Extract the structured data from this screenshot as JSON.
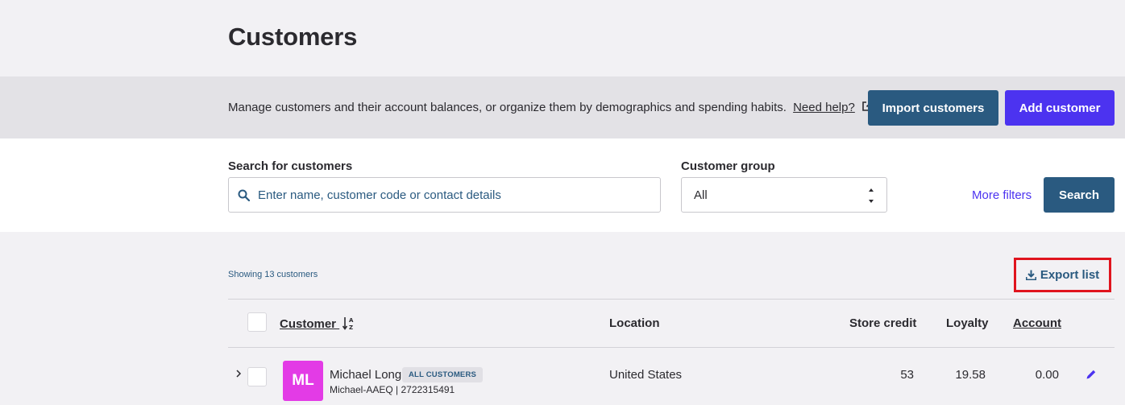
{
  "page": {
    "title": "Customers"
  },
  "banner": {
    "description": "Manage customers and their account balances, or organize them by demographics and spending habits.",
    "help_link": "Need help?",
    "import_label": "Import customers",
    "add_label": "Add customer"
  },
  "filters": {
    "search_label": "Search for customers",
    "search_placeholder": "Enter name, customer code or contact details",
    "group_label": "Customer group",
    "group_value": "All",
    "more_filters": "More filters",
    "search_button": "Search"
  },
  "list": {
    "showing": "Showing 13 customers",
    "export_label": "Export list"
  },
  "table": {
    "headers": {
      "customer": "Customer",
      "location": "Location",
      "store_credit": "Store credit",
      "loyalty": "Loyalty",
      "account": "Account"
    },
    "rows": [
      {
        "initials": "ML",
        "name": "Michael Long",
        "group": "ALL CUSTOMERS",
        "code": "Michael-AAEQ | 2722315491",
        "location": "United States",
        "store_credit": "53",
        "loyalty": "19.58",
        "account": "0.00"
      }
    ]
  },
  "colors": {
    "primary": "#2a5a80",
    "accent": "#4c33f0",
    "avatar": "#e33be6",
    "highlight": "#e0141e"
  },
  "icons": [
    "search-icon",
    "external-link-icon",
    "select-arrows-icon",
    "download-icon",
    "sort-alpha-icon",
    "chevron-right-icon",
    "pencil-icon"
  ]
}
